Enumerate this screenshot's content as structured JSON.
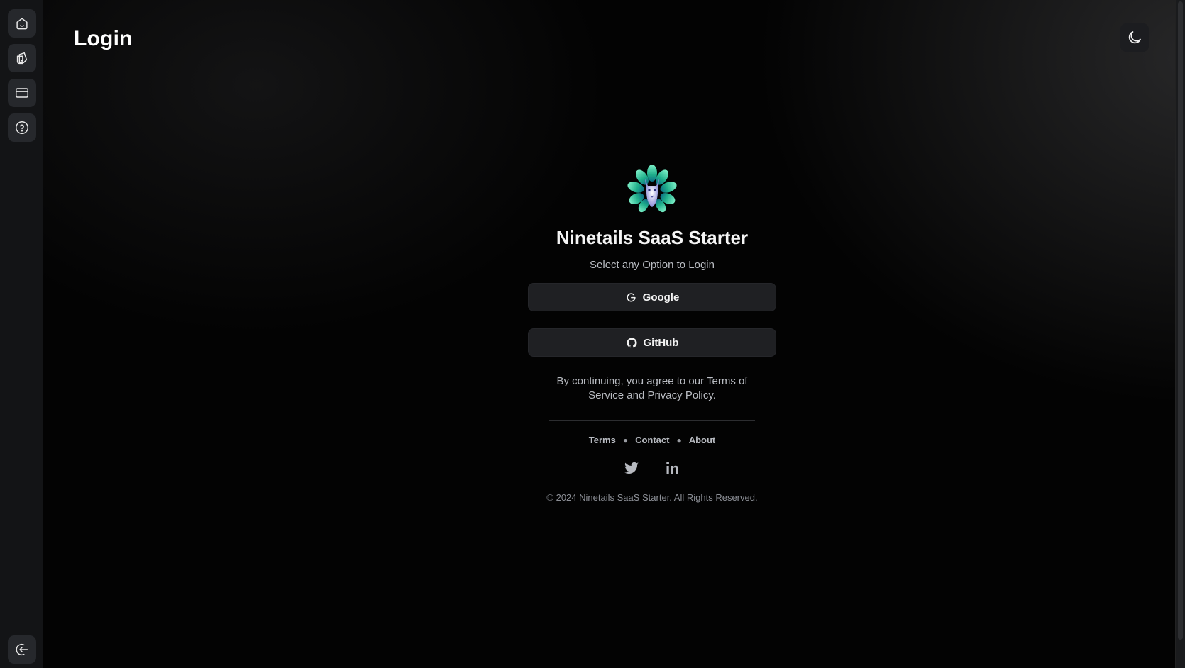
{
  "page": {
    "title": "Login"
  },
  "sidebar": {
    "items": [
      {
        "name": "home",
        "icon": "home-icon"
      },
      {
        "name": "pages",
        "icon": "sticky-notes-icon"
      },
      {
        "name": "billing",
        "icon": "credit-card-icon"
      },
      {
        "name": "help",
        "icon": "help-circle-icon"
      }
    ],
    "bottom": {
      "name": "logout",
      "icon": "logout-icon"
    }
  },
  "header": {
    "theme_toggle_icon": "moon-icon"
  },
  "login": {
    "app_name": "Ninetails SaaS Starter",
    "subtitle": "Select any Option to Login",
    "google_label": "Google",
    "github_label": "GitHub",
    "terms_note": "By continuing, you agree to our Terms of Service and Privacy Policy."
  },
  "footer": {
    "links": [
      "Terms",
      "Contact",
      "About"
    ],
    "social": [
      "twitter-icon",
      "linkedin-icon"
    ],
    "copyright": "© 2024 Ninetails SaaS Starter. All Rights Reserved."
  },
  "colors": {
    "background": "#030303",
    "sidebar": "#131416",
    "button": "#1f2023",
    "text": "#f5f5f5",
    "muted": "#b9bcc2"
  }
}
